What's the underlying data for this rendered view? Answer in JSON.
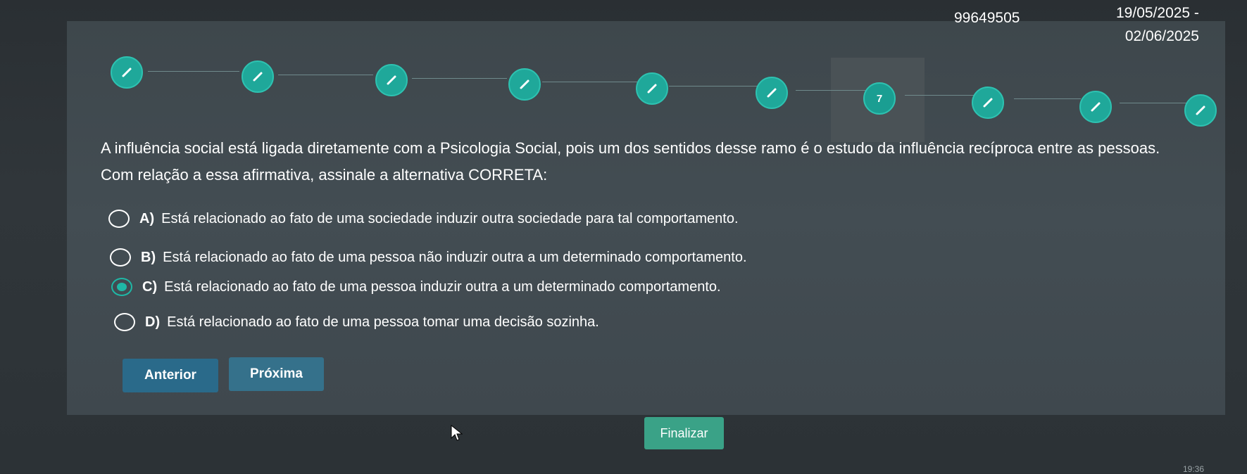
{
  "header": {
    "id": "99649505",
    "date_line1": "19/05/2025 -",
    "date_line2": "02/06/2025"
  },
  "steps": [
    {
      "label": "",
      "icon": "pencil-icon"
    },
    {
      "label": "",
      "icon": "pencil-icon"
    },
    {
      "label": "",
      "icon": "pencil-icon"
    },
    {
      "label": "",
      "icon": "pencil-icon"
    },
    {
      "label": "",
      "icon": "pencil-icon"
    },
    {
      "label": "",
      "icon": "pencil-icon"
    },
    {
      "label": "7",
      "icon": ""
    },
    {
      "label": "",
      "icon": "pencil-icon"
    },
    {
      "label": "",
      "icon": "pencil-icon"
    },
    {
      "label": "",
      "icon": "pencil-icon"
    }
  ],
  "question": {
    "text": "A influência social está ligada diretamente com a Psicologia Social, pois um dos sentidos desse ramo é o estudo da influência recíproca entre as pessoas. Com relação a essa afirmativa, assinale a alternativa CORRETA:"
  },
  "options": [
    {
      "letter": "A)",
      "text": "Está relacionado ao fato de uma sociedade induzir outra sociedade para tal comportamento.",
      "selected": false
    },
    {
      "letter": "B)",
      "text": "Está relacionado ao fato de uma pessoa não induzir outra a um determinado comportamento.",
      "selected": false
    },
    {
      "letter": "C)",
      "text": "Está relacionado ao fato de uma pessoa induzir outra a um determinado comportamento.",
      "selected": true
    },
    {
      "letter": "D)",
      "text": "Está relacionado ao fato de uma pessoa tomar uma decisão sozinha.",
      "selected": false
    }
  ],
  "buttons": {
    "prev": "Anterior",
    "next": "Próxima",
    "finish": "Finalizar"
  },
  "clock": "19:36",
  "colors": {
    "accent": "#1fa89a",
    "finish": "#3aa287",
    "nav": "#2a6a8a"
  }
}
